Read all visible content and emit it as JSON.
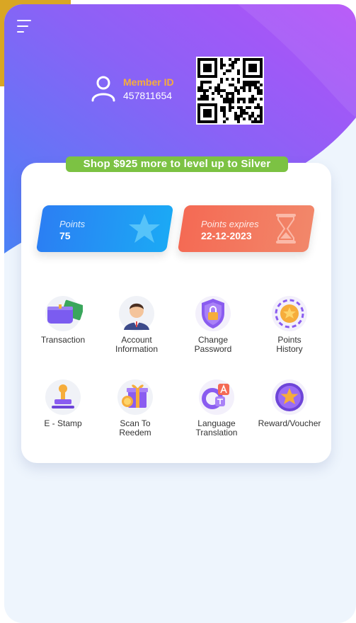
{
  "header": {
    "menu_icon": "hamburger-menu-icon",
    "member_id_label": "Member ID",
    "member_id_value": "457811654"
  },
  "level_banner": "Shop $925 more to level up to Silver",
  "summary": {
    "points_label": "Points",
    "points_value": "75",
    "expires_label": "Points expires",
    "expires_value": "22-12-2023"
  },
  "menu": {
    "transaction": "Transaction",
    "account_line1": "Account",
    "account_line2": "Information",
    "change_line1": "Change",
    "change_line2": "Password",
    "points_line1": "Points",
    "points_line2": "History",
    "estamp": "E - Stamp",
    "scan_line1": "Scan To",
    "scan_line2": "Reedem",
    "lang_line1": "Language",
    "lang_line2": "Translation",
    "reward": "Reward/Voucher"
  },
  "colors": {
    "gradient_start": "#4d7bf5",
    "gradient_end": "#b24ff7",
    "banner": "#7cc243",
    "points_tile": "#2b7ff3",
    "expires_tile": "#f46a54",
    "member_label": "#f6ad3b"
  }
}
